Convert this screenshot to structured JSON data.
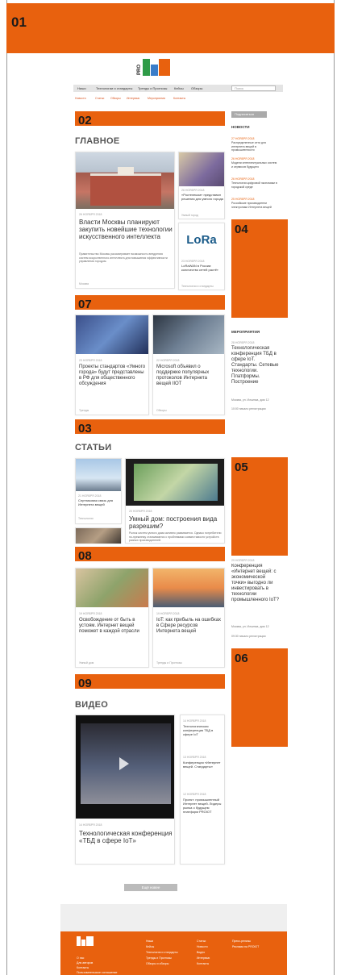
{
  "ads": {
    "top": "01",
    "bars": [
      "02",
      "07",
      "03",
      "08",
      "09"
    ],
    "side": [
      "04",
      "05",
      "06"
    ]
  },
  "logo": {
    "pro": "PRO"
  },
  "nav": {
    "items": [
      "Ниши",
      "Технологии и стандарты",
      "Тренды и Прогнозы",
      "Кейсы",
      "Обзоры"
    ],
    "search_placeholder": "Поиск",
    "sub": [
      "Новости",
      "Статьи",
      "Обзоры",
      "Интервью",
      "Мероприятия",
      "Контакты"
    ]
  },
  "sections": {
    "main": "ГЛАВНОЕ",
    "articles": "СТАТЬИ",
    "video": "ВИДЕО"
  },
  "main": {
    "big": {
      "date": "26 НОЯБРЯ 2018",
      "title": "Власти Москвы планируют закупить новейшие технологии искусственного интеллекта",
      "text": "Правительство Москвы рассматривает возможность внедрения систем искусственного интеллекта для повышения эффективности управления городом.",
      "meta": "Москва"
    },
    "small1": {
      "date": "26 НОЯБРЯ 2018",
      "title": "«Ростелеком» представил решения для умного города",
      "meta": "Умный город"
    },
    "small2": {
      "logo": "LoRa",
      "date": "23 НОЯБРЯ 2018",
      "title": "LoRaWAN в России: количество сетей растёт",
      "meta": "Технологии и стандарты"
    },
    "row2a": {
      "date": "23 НОЯБРЯ 2018",
      "title": "Проекты стандартов «Умного города» будут представлены в РФ для общественного обсуждения",
      "meta": "Тренды"
    },
    "row2b": {
      "date": "22 НОЯБРЯ 2018",
      "title": "Microsoft объявил о поддержке популярных протоколов Интернета вещей IIOT",
      "meta": "Обзоры"
    }
  },
  "articles": {
    "a1": {
      "date": "21 НОЯБРЯ 2018",
      "title": "Спутниковая связь для Интернета вещей",
      "meta": "Технологии"
    },
    "a2": {
      "date": "20 НОЯБРЯ 2018",
      "title": "Умные счётчики: итоги года",
      "meta": "Кейсы"
    },
    "big": {
      "date": "20 НОЯБРЯ 2018",
      "title": "Умный дом: построения вида разрешим?",
      "text": "Рынок систем умного дома активно развивается. Однако потребители по-прежнему сталкиваются с проблемами совместимости устройств разных производителей.",
      "meta": "Тренды и Прогнозы"
    },
    "row2a": {
      "date": "19 НОЯБРЯ 2018",
      "title": "Освобождение от быть в устоям. Интернет вещей поможет в каждой отрасли",
      "meta": "Умный дом"
    },
    "row2b": {
      "date": "19 НОЯБРЯ 2018",
      "title": "IoT: как прибыль на ошибках в Сфере ресурсов Интернета вещей",
      "meta": "Тренды и Прогнозы"
    }
  },
  "video": {
    "main": {
      "date": "14 НОЯБРЯ 2018",
      "title": "Технологическая конференция «ТБД в сфере IoT»"
    },
    "list": [
      {
        "date": "14 НОЯБРЯ 2018",
        "title": "Технологическая конференция ТБД в сфере IoT"
      },
      {
        "date": "13 НОЯБРЯ 2018",
        "title": "Конференция «Интернет вещей. Стандарты»"
      },
      {
        "date": "12 НОЯБРЯ 2018",
        "title": "Проект: промышленный Интернет вещей. Лидеры рынка о будущем платформ PROIOT"
      }
    ]
  },
  "sidebar": {
    "button": "Подписаться",
    "news_title": "НОВОСТИ",
    "news": [
      {
        "date": "27 НОЯБРЯ 2018",
        "text": "Распределенные сети для интернета вещей в промышленности"
      },
      {
        "date": "26 НОЯБРЯ 2018",
        "text": "Модели интеллектуальных систем и сервисов будущего"
      },
      {
        "date": "26 НОЯБРЯ 2018",
        "text": "Технологии цифровой экономики в городской среде"
      },
      {
        "date": "25 НОЯБРЯ 2018",
        "text": "Российские производители электроники Интернета вещей"
      }
    ],
    "events_title": "МЕРОПРИЯТИЯ",
    "event1": {
      "date": "28 НОЯБРЯ 2018",
      "title": "Технологическая конференция ТБД в сфере IoT. Стандарты. Сетевые технологии. Платформы. Построение",
      "place": "Москва, ул. Ильинка, дом 12",
      "time": "10:00 начало регистрации"
    },
    "event2": {
      "date": "29 НОЯБРЯ 2018",
      "title": "Конференция «Интернет вещей: с экономической точки» выгодно ли инвестировать в технологии промышленного IoT?",
      "place": "Москва, ул. Ильинка, дом 12",
      "time": "09:30 начало регистрации"
    }
  },
  "more_button": "Ещё новее",
  "footer": {
    "col1": [
      "Ниши",
      "Кейсы",
      "Технологии и стандарты",
      "Тренды и Прогнозы",
      "Обзоры и обзоры"
    ],
    "col2": [
      "Статьи",
      "Новости",
      "Видео",
      "Интервью",
      "Контакты"
    ],
    "col3": [
      "Пресс-релизы",
      "Реклама на PROIOT"
    ],
    "left": [
      "О нас",
      "Для авторов",
      "Контакты",
      "Пользовательское соглашение"
    ]
  },
  "colors": {
    "accent": "#e8610e",
    "green": "#2e9b47",
    "blue": "#3a7dc9"
  }
}
